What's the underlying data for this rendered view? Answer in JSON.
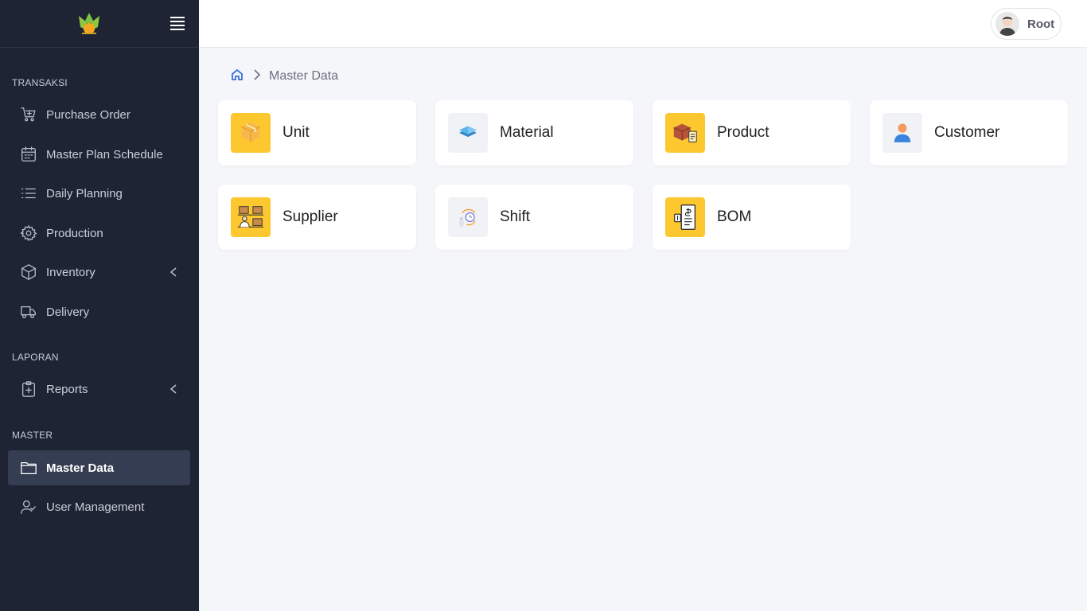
{
  "sidebar": {
    "sections": {
      "transaksi": "TRANSAKSI",
      "laporan": "LAPORAN",
      "master": "MASTER"
    },
    "items": [
      {
        "label": "Purchase Order",
        "icon": "cart-plus-icon"
      },
      {
        "label": "Master Plan Schedule",
        "icon": "calendar-icon"
      },
      {
        "label": "Daily Planning",
        "icon": "list-icon"
      },
      {
        "label": "Production",
        "icon": "gear-icon"
      },
      {
        "label": "Inventory",
        "icon": "box-icon"
      },
      {
        "label": "Delivery",
        "icon": "truck-icon"
      },
      {
        "label": "Reports",
        "icon": "clipboard-plus-icon"
      },
      {
        "label": "Master Data",
        "icon": "folder-icon"
      },
      {
        "label": "User Management",
        "icon": "user-check-icon"
      }
    ]
  },
  "header": {
    "user_name": "Root"
  },
  "breadcrumb": {
    "current": "Master Data"
  },
  "cards": [
    {
      "label": "Unit"
    },
    {
      "label": "Material"
    },
    {
      "label": "Product"
    },
    {
      "label": "Customer"
    },
    {
      "label": "Supplier"
    },
    {
      "label": "Shift"
    },
    {
      "label": "BOM"
    }
  ],
  "colors": {
    "sidebar_bg": "#1e2433",
    "active_bg": "#353d52",
    "accent_yellow": "#fdc72f",
    "home_blue": "#3b6fd8"
  }
}
